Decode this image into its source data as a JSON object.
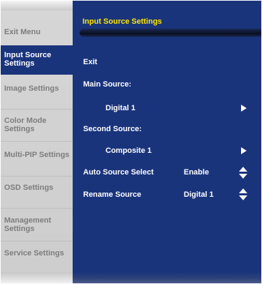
{
  "colors": {
    "panel_background": "#1a347c",
    "sidebar_background": "#d3d3d3",
    "sidebar_text": "#7d7d7d",
    "title_text": "#ffe600",
    "menu_text": "#ffffff"
  },
  "sidebar": {
    "items": [
      {
        "label": "Exit Menu",
        "active": false
      },
      {
        "label": "Input Source Settings",
        "active": true
      },
      {
        "label": "Image Settings",
        "active": false
      },
      {
        "label": "Color Mode Settings",
        "active": false
      },
      {
        "label": "Multi-PIP Settings",
        "active": false
      },
      {
        "label": "OSD Settings",
        "active": false
      },
      {
        "label": "Management Settings",
        "active": false
      },
      {
        "label": "Service Settings",
        "active": false
      }
    ]
  },
  "main": {
    "title": "Input Source Settings",
    "exit_label": "Exit",
    "main_source": {
      "label": "Main Source:",
      "value": "Digital 1",
      "icon": "arrow-right-icon"
    },
    "second_source": {
      "label": "Second Source:",
      "value": "Composite 1",
      "icon": "arrow-right-icon"
    },
    "auto_source_select": {
      "label": "Auto Source Select",
      "value": "Enable",
      "icon": "up-down-arrows-icon"
    },
    "rename_source": {
      "label": "Rename Source",
      "value": "Digital 1",
      "icon": "up-down-arrows-icon"
    }
  }
}
